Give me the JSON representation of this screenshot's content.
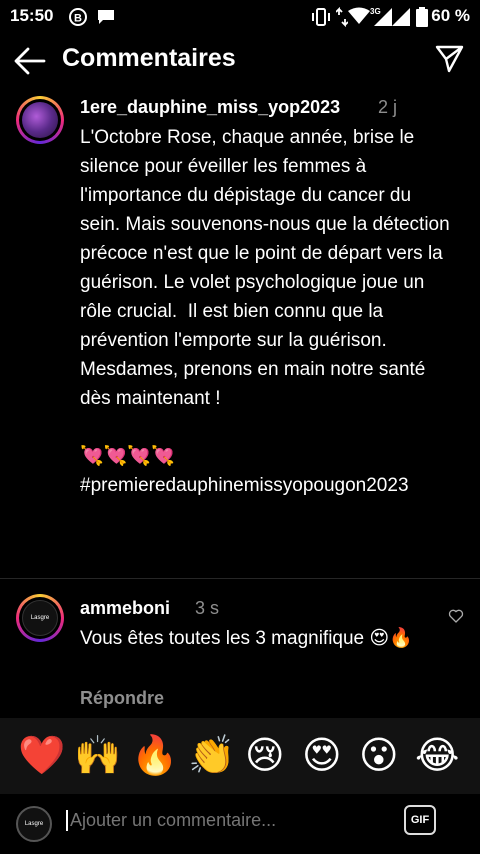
{
  "status_bar": {
    "time": "15:50",
    "battery": "60 %"
  },
  "header": {
    "title": "Commentaires"
  },
  "comments": [
    {
      "username": "1ere_dauphine_miss_yop2023",
      "time": "2 j",
      "text": "L'Octobre Rose, chaque année, brise le silence pour éveiller les femmes à l'importance du dépistage du cancer du sein. Mais souvenons-nous que la détection précoce n'est que le point de départ vers la guérison. Le volet psychologique joue un rôle crucial.  Il est bien connu que la prévention l'emporte sur la guérison. Mesdames, prenons en main notre santé dès maintenant !\n\n💘💘💘💘\n#premieredauphinemissyopougon2023"
    },
    {
      "username": "ammeboni",
      "time": "3 s",
      "text": "Vous êtes toutes les 3 magnifique 😍🔥",
      "reply_label": "Répondre",
      "avatar_text": "Lasgre"
    }
  ],
  "emoji_bar": [
    "❤️",
    "🙌",
    "🔥",
    "👏",
    "😢",
    "😍",
    "😮",
    "😂"
  ],
  "input": {
    "placeholder": "Ajouter un commentaire...",
    "avatar_text": "Lasgre",
    "gif_label": "GIF"
  }
}
